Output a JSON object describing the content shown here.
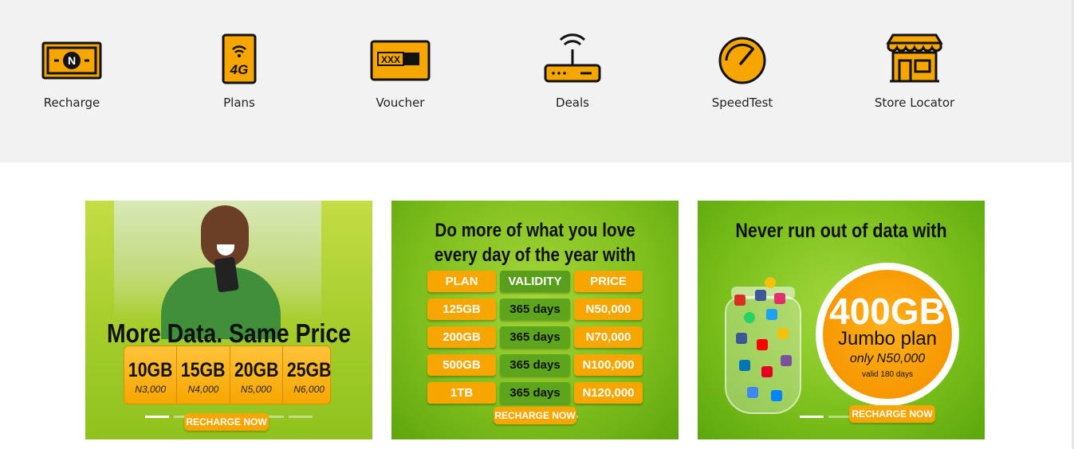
{
  "quicklinks": [
    {
      "label": "Recharge",
      "icon": "recharge-icon"
    },
    {
      "label": "Plans",
      "icon": "plans-icon",
      "icon_text": "4G"
    },
    {
      "label": "Voucher",
      "icon": "voucher-icon",
      "icon_text": "XXX"
    },
    {
      "label": "Deals",
      "icon": "router-icon"
    },
    {
      "label": "SpeedTest",
      "icon": "speedometer-icon"
    },
    {
      "label": "Store Locator",
      "icon": "store-icon"
    }
  ],
  "colors": {
    "accent": "#f7a600",
    "icon_stroke": "#111111",
    "banner_green": "#8fc21e",
    "quicklinks_bg": "#f2f2f2"
  },
  "banners": [
    {
      "headline": "More Data. Same Price",
      "bundles": [
        {
          "size": "10GB",
          "price": "N3,000"
        },
        {
          "size": "15GB",
          "price": "N4,000"
        },
        {
          "size": "20GB",
          "price": "N5,000"
        },
        {
          "size": "25GB",
          "price": "N6,000"
        }
      ],
      "cta": "RECHARGE NOW"
    },
    {
      "headline_line1": "Do more of what you love",
      "headline_line2": "every day of the year with",
      "table_headers": [
        "PLAN",
        "VALIDITY",
        "PRICE"
      ],
      "table_rows": [
        [
          "125GB",
          "365 days",
          "N50,000"
        ],
        [
          "200GB",
          "365 days",
          "N70,000"
        ],
        [
          "500GB",
          "365 days",
          "N100,000"
        ],
        [
          "1TB",
          "365 days",
          "N120,000"
        ]
      ],
      "cta": "RECHARGE NOW"
    },
    {
      "headline": "Never run out of data with",
      "plan_size": "400GB",
      "plan_name": "Jumbo plan",
      "plan_price": "only N50,000",
      "plan_validity": "valid 180 days",
      "cta": "RECHARGE NOW"
    }
  ]
}
